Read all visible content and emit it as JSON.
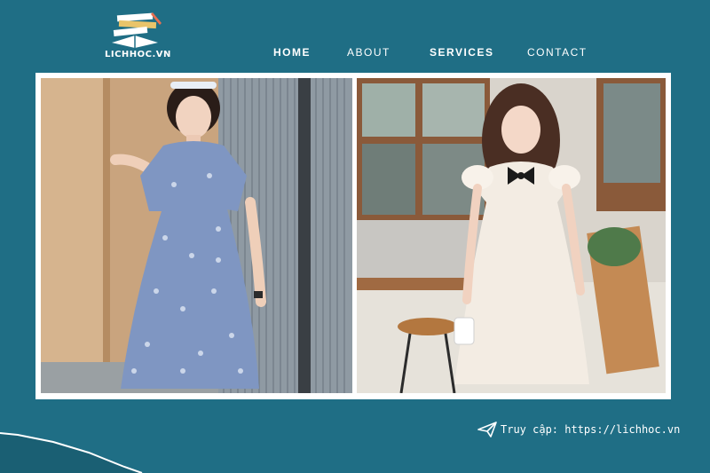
{
  "logo": {
    "text": "LICHHOC.VN",
    "icon": "book-stack-icon"
  },
  "nav": {
    "home": "HOME",
    "about": "ABOUT",
    "services": "SERVICES",
    "contact": "CONTACT"
  },
  "photos": {
    "left": {
      "icon": "floral-dress-photo"
    },
    "right": {
      "icon": "white-dress-photo"
    }
  },
  "footer": {
    "icon": "paper-plane-icon",
    "text": "Truy cập: https://lichhoc.vn"
  },
  "colors": {
    "background": "#1f6e85",
    "frame": "#ffffff",
    "text": "#ffffff"
  }
}
